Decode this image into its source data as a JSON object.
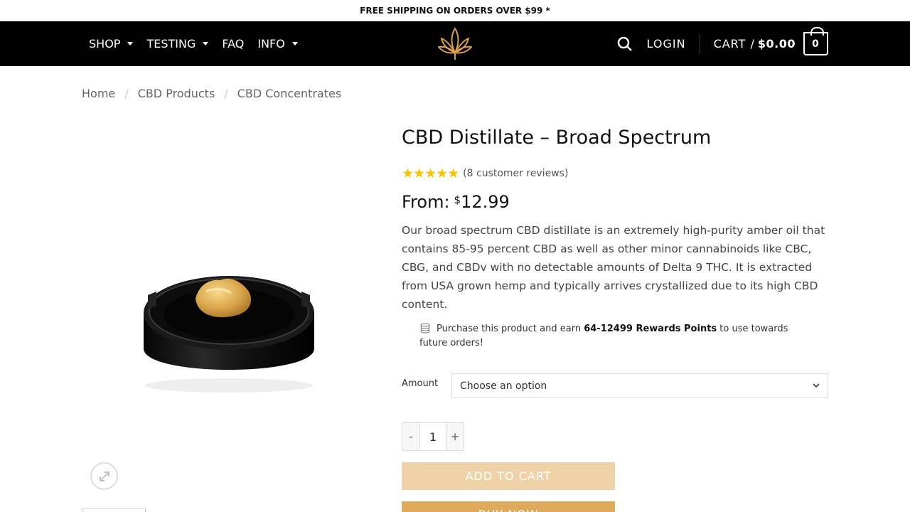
{
  "topbar": {
    "text": "FREE SHIPPING ON ORDERS OVER $99 *"
  },
  "nav": {
    "items": [
      {
        "label": "SHOP",
        "dropdown": true
      },
      {
        "label": "TESTING",
        "dropdown": true
      },
      {
        "label": "FAQ",
        "dropdown": false
      },
      {
        "label": "INFO",
        "dropdown": true
      }
    ],
    "logo_icon": "cannabis-leaf-icon",
    "search_icon": "search-icon",
    "login_label": "LOGIN",
    "cart_label": "CART /",
    "cart_amount": "$0.00",
    "cart_count": "0"
  },
  "breadcrumb": {
    "items": [
      "Home",
      "CBD Products",
      "CBD Concentrates"
    ],
    "separator": "/"
  },
  "product": {
    "title": "CBD Distillate – Broad Spectrum",
    "rating_stars": "★★★★★",
    "rating_value": 5,
    "reviews": "(8 customer reviews)",
    "price_prefix": "From:",
    "currency": "$",
    "price": "12.99",
    "description": "Our broad spectrum CBD distillate is an extremely high-purity amber oil that contains 85-95 percent CBD as well as other minor cannabinoids like CBC, CBG, and CBDv with no detectable amounts of Delta 9 THC. It is extracted from USA grown hemp and typically arrives crystallized due to its high CBD content.",
    "rewards_pre": "Purchase this product and earn",
    "rewards_points": "64-12499 Rewards Points",
    "rewards_post": "to use towards future orders!",
    "amount_label": "Amount",
    "amount_select": "Choose an option",
    "qty_minus": "-",
    "qty_value": "1",
    "qty_plus": "+",
    "add_to_cart": "ADD TO CART",
    "buy_now": "BUY NOW"
  },
  "colors": {
    "header_bg": "#000000",
    "star": "#f5c400",
    "add_to_cart_bg": "#f0d2a8",
    "buy_now_bg": "#dfa95c",
    "logo": "#d9a04a"
  }
}
